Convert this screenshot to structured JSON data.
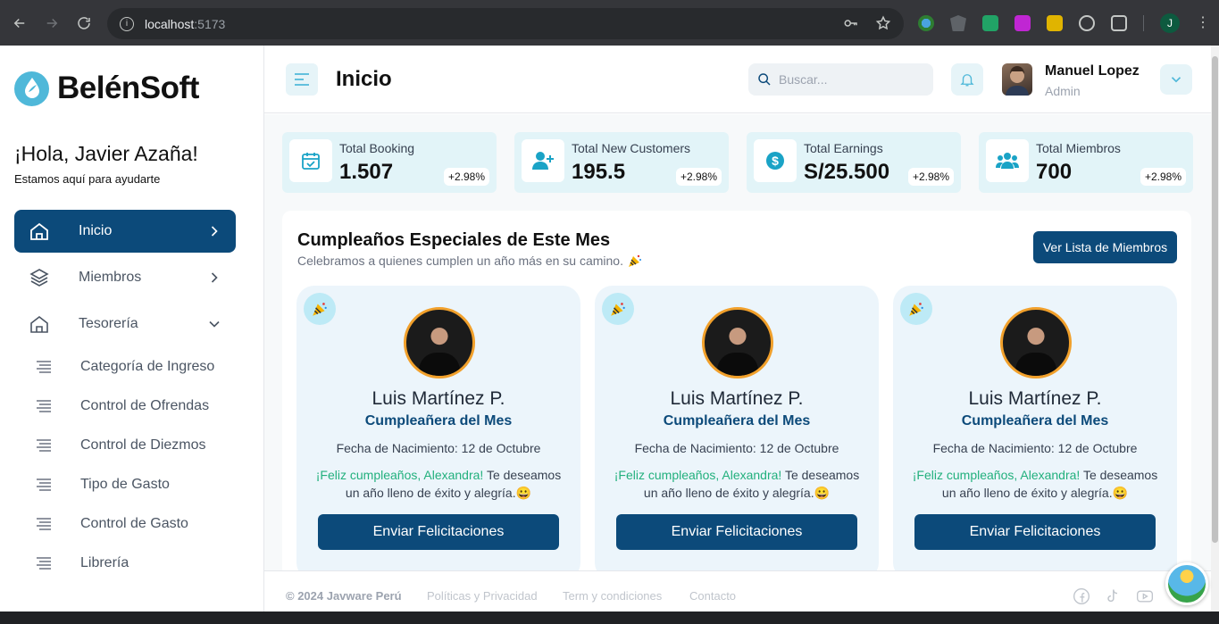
{
  "browser": {
    "url_host": "localhost",
    "url_port": ":5173",
    "profile_initial": "J"
  },
  "sidebar": {
    "brand": "BelénSoft",
    "greeting": "¡Hola, Javier Azaña!",
    "greeting_sub": "Estamos aquí para ayudarte",
    "items": [
      {
        "label": "Inicio",
        "icon": "home-icon"
      },
      {
        "label": "Miembros",
        "icon": "layers-icon"
      },
      {
        "label": "Tesorería",
        "icon": "home-icon"
      }
    ],
    "subitems": [
      {
        "label": "Categoría de Ingreso"
      },
      {
        "label": "Control de Ofrendas"
      },
      {
        "label": "Control de Diezmos"
      },
      {
        "label": "Tipo de Gasto"
      },
      {
        "label": "Control de Gasto"
      },
      {
        "label": "Librería"
      }
    ]
  },
  "header": {
    "title": "Inicio",
    "search_placeholder": "Buscar...",
    "user_name": "Manuel Lopez",
    "user_role": "Admin"
  },
  "stats": [
    {
      "label": "Total Booking",
      "value": "1.507",
      "badge": "+2.98%",
      "icon": "calendar-check-icon"
    },
    {
      "label": "Total New Customers",
      "value": "195.5",
      "badge": "+2.98%",
      "icon": "user-plus-icon"
    },
    {
      "label": "Total Earnings",
      "value": "S/25.500",
      "badge": "+2.98%",
      "icon": "dollar-icon"
    },
    {
      "label": "Total Miembros",
      "value": "700",
      "badge": "+2.98%",
      "icon": "users-icon"
    }
  ],
  "birthdays": {
    "title": "Cumpleaños Especiales de Este Mes",
    "subtitle": "Celebramos a quienes cumplen un año más en su camino.",
    "button": "Ver Lista de Miembros",
    "cards": [
      {
        "name": "Luis Martínez P.",
        "role": "Cumpleañera del Mes",
        "dob": "Fecha de Nacimiento: 12 de Octubre",
        "greeting": "¡Feliz cumpleaños, Alexandra!",
        "message": " Te deseamos un año lleno de éxito y alegría.",
        "button": "Enviar Felicitaciones"
      },
      {
        "name": "Luis Martínez P.",
        "role": "Cumpleañera del Mes",
        "dob": "Fecha de Nacimiento: 12 de Octubre",
        "greeting": "¡Feliz cumpleaños, Alexandra!",
        "message": " Te deseamos un año lleno de éxito y alegría.",
        "button": "Enviar Felicitaciones"
      },
      {
        "name": "Luis Martínez P.",
        "role": "Cumpleañera del Mes",
        "dob": "Fecha de Nacimiento: 12 de Octubre",
        "greeting": "¡Feliz cumpleaños, Alexandra!",
        "message": " Te deseamos un año lleno de éxito y alegría.",
        "button": "Enviar Felicitaciones"
      }
    ]
  },
  "footer": {
    "copyright": "© 2024 Javware Perú",
    "links": [
      "Políticas y Privacidad",
      "Term y condiciones",
      "Contacto"
    ]
  },
  "colors": {
    "primary": "#0c4a7a",
    "accent": "#4fb8d9",
    "card_bg": "#ecf5fb",
    "highlight": "#22b07d"
  }
}
